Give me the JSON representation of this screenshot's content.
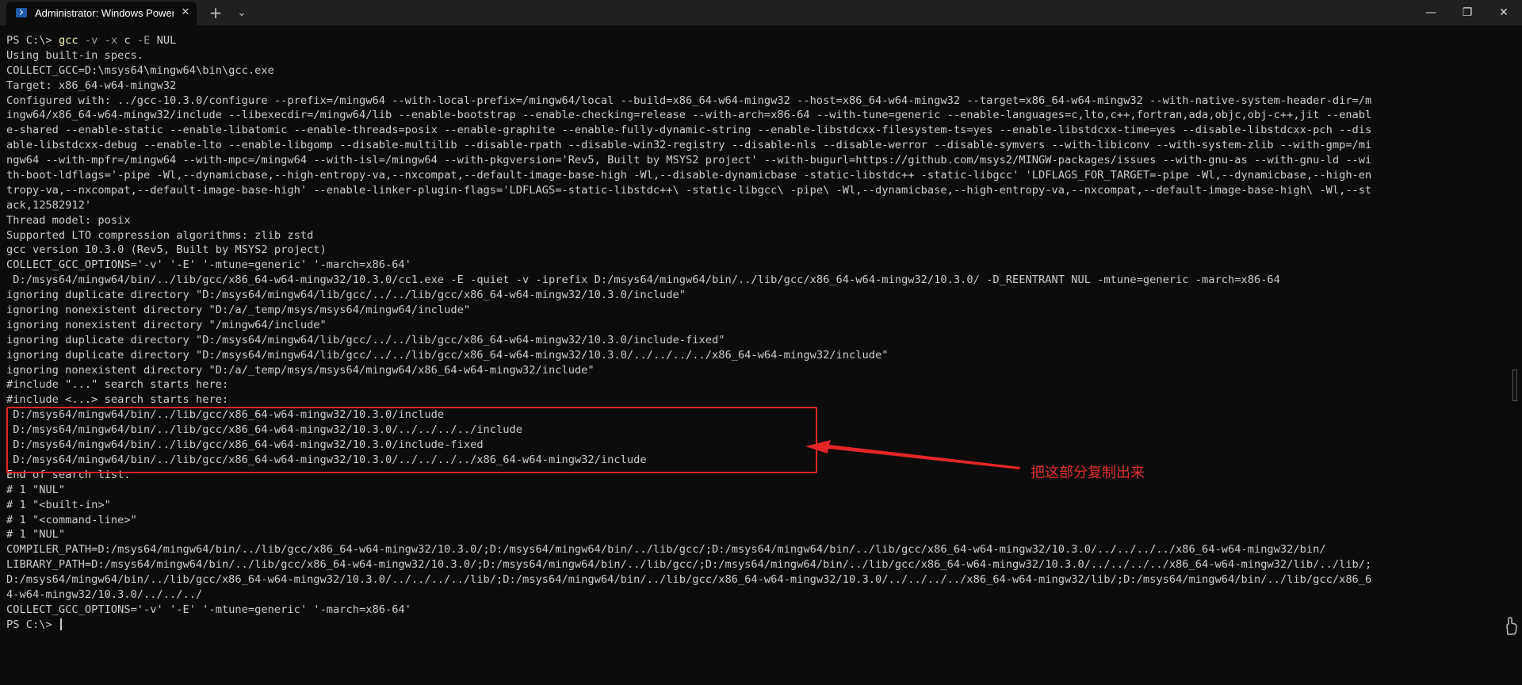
{
  "window": {
    "tab_title": "Administrator: Windows PowerShell",
    "tab_close_glyph": "✕",
    "new_tab_glyph": "+",
    "dropdown_glyph": "⌄",
    "minimize_glyph": "—",
    "maximize_glyph": "❐",
    "close_glyph": "✕"
  },
  "terminal": {
    "prompt": "PS C:\\> ",
    "command": {
      "name": "gcc",
      "args": [
        " ",
        "-v",
        " ",
        "-x",
        " c ",
        "-E",
        " NUL"
      ]
    },
    "lines": [
      "Using built-in specs.",
      "COLLECT_GCC=D:\\msys64\\mingw64\\bin\\gcc.exe",
      "Target: x86_64-w64-mingw32",
      "Configured with: ../gcc-10.3.0/configure --prefix=/mingw64 --with-local-prefix=/mingw64/local --build=x86_64-w64-mingw32 --host=x86_64-w64-mingw32 --target=x86_64-w64-mingw32 --with-native-system-header-dir=/m",
      "ingw64/x86_64-w64-mingw32/include --libexecdir=/mingw64/lib --enable-bootstrap --enable-checking=release --with-arch=x86-64 --with-tune=generic --enable-languages=c,lto,c++,fortran,ada,objc,obj-c++,jit --enabl",
      "e-shared --enable-static --enable-libatomic --enable-threads=posix --enable-graphite --enable-fully-dynamic-string --enable-libstdcxx-filesystem-ts=yes --enable-libstdcxx-time=yes --disable-libstdcxx-pch --dis",
      "able-libstdcxx-debug --enable-lto --enable-libgomp --disable-multilib --disable-rpath --disable-win32-registry --disable-nls --disable-werror --disable-symvers --with-libiconv --with-system-zlib --with-gmp=/mi",
      "ngw64 --with-mpfr=/mingw64 --with-mpc=/mingw64 --with-isl=/mingw64 --with-pkgversion='Rev5, Built by MSYS2 project' --with-bugurl=https://github.com/msys2/MINGW-packages/issues --with-gnu-as --with-gnu-ld --wi",
      "th-boot-ldflags='-pipe -Wl,--dynamicbase,--high-entropy-va,--nxcompat,--default-image-base-high -Wl,--disable-dynamicbase -static-libstdc++ -static-libgcc' 'LDFLAGS_FOR_TARGET=-pipe -Wl,--dynamicbase,--high-en",
      "tropy-va,--nxcompat,--default-image-base-high' --enable-linker-plugin-flags='LDFLAGS=-static-libstdc++\\ -static-libgcc\\ -pipe\\ -Wl,--dynamicbase,--high-entropy-va,--nxcompat,--default-image-base-high\\ -Wl,--st",
      "ack,12582912'",
      "Thread model: posix",
      "Supported LTO compression algorithms: zlib zstd",
      "gcc version 10.3.0 (Rev5, Built by MSYS2 project)",
      "COLLECT_GCC_OPTIONS='-v' '-E' '-mtune=generic' '-march=x86-64'",
      " D:/msys64/mingw64/bin/../lib/gcc/x86_64-w64-mingw32/10.3.0/cc1.exe -E -quiet -v -iprefix D:/msys64/mingw64/bin/../lib/gcc/x86_64-w64-mingw32/10.3.0/ -D_REENTRANT NUL -mtune=generic -march=x86-64",
      "ignoring duplicate directory \"D:/msys64/mingw64/lib/gcc/../../lib/gcc/x86_64-w64-mingw32/10.3.0/include\"",
      "ignoring nonexistent directory \"D:/a/_temp/msys/msys64/mingw64/include\"",
      "ignoring nonexistent directory \"/mingw64/include\"",
      "ignoring duplicate directory \"D:/msys64/mingw64/lib/gcc/../../lib/gcc/x86_64-w64-mingw32/10.3.0/include-fixed\"",
      "ignoring duplicate directory \"D:/msys64/mingw64/lib/gcc/../../lib/gcc/x86_64-w64-mingw32/10.3.0/../../../../x86_64-w64-mingw32/include\"",
      "ignoring nonexistent directory \"D:/a/_temp/msys/msys64/mingw64/x86_64-w64-mingw32/include\"",
      "#include \"...\" search starts here:",
      "#include <...> search starts here:",
      " D:/msys64/mingw64/bin/../lib/gcc/x86_64-w64-mingw32/10.3.0/include",
      " D:/msys64/mingw64/bin/../lib/gcc/x86_64-w64-mingw32/10.3.0/../../../../include",
      " D:/msys64/mingw64/bin/../lib/gcc/x86_64-w64-mingw32/10.3.0/include-fixed",
      " D:/msys64/mingw64/bin/../lib/gcc/x86_64-w64-mingw32/10.3.0/../../../../x86_64-w64-mingw32/include",
      "End of search list.",
      "# 1 \"NUL\"",
      "# 1 \"<built-in>\"",
      "# 1 \"<command-line>\"",
      "# 1 \"NUL\"",
      "COMPILER_PATH=D:/msys64/mingw64/bin/../lib/gcc/x86_64-w64-mingw32/10.3.0/;D:/msys64/mingw64/bin/../lib/gcc/;D:/msys64/mingw64/bin/../lib/gcc/x86_64-w64-mingw32/10.3.0/../../../../x86_64-w64-mingw32/bin/",
      "LIBRARY_PATH=D:/msys64/mingw64/bin/../lib/gcc/x86_64-w64-mingw32/10.3.0/;D:/msys64/mingw64/bin/../lib/gcc/;D:/msys64/mingw64/bin/../lib/gcc/x86_64-w64-mingw32/10.3.0/../../../../x86_64-w64-mingw32/lib/../lib/;",
      "D:/msys64/mingw64/bin/../lib/gcc/x86_64-w64-mingw32/10.3.0/../../../../lib/;D:/msys64/mingw64/bin/../lib/gcc/x86_64-w64-mingw32/10.3.0/../../../../x86_64-w64-mingw32/lib/;D:/msys64/mingw64/bin/../lib/gcc/x86_6",
      "4-w64-mingw32/10.3.0/../../../",
      "COLLECT_GCC_OPTIONS='-v' '-E' '-mtune=generic' '-march=x86-64'"
    ],
    "final_prompt": "PS C:\\> "
  },
  "annotation": {
    "text": "把这部分复制出来",
    "color": "#e52626"
  },
  "colors": {
    "background": "#0c0c0c",
    "titlebar": "#202020",
    "text": "#cccccc",
    "command": "#f2f2a8",
    "parameter": "#9e9e9e"
  }
}
